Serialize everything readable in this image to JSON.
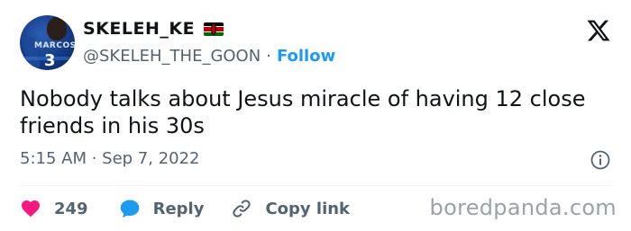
{
  "author": {
    "display_name": "SKELEH_KE",
    "handle": "@SKELEH_THE_GOON",
    "separator": "·",
    "follow_label": "Follow",
    "flag_icon": "kenya-flag-icon",
    "avatar_shirt_text": "MARCOS",
    "avatar_number": "3"
  },
  "platform_icon": "x-logo-icon",
  "tweet": {
    "text": "Nobody talks about Jesus miracle of having 12 close friends in his 30s",
    "timestamp": "5:15 AM · Sep 7, 2022"
  },
  "actions": {
    "like_icon": "heart-icon",
    "like_count": "249",
    "reply_icon": "speech-bubble-icon",
    "reply_label": "Reply",
    "copy_icon": "link-icon",
    "copy_label": "Copy link"
  },
  "watermark": "boredpanda.com",
  "colors": {
    "accent": "#1d9bf0",
    "like": "#f91880",
    "secondary_text": "#536471"
  }
}
